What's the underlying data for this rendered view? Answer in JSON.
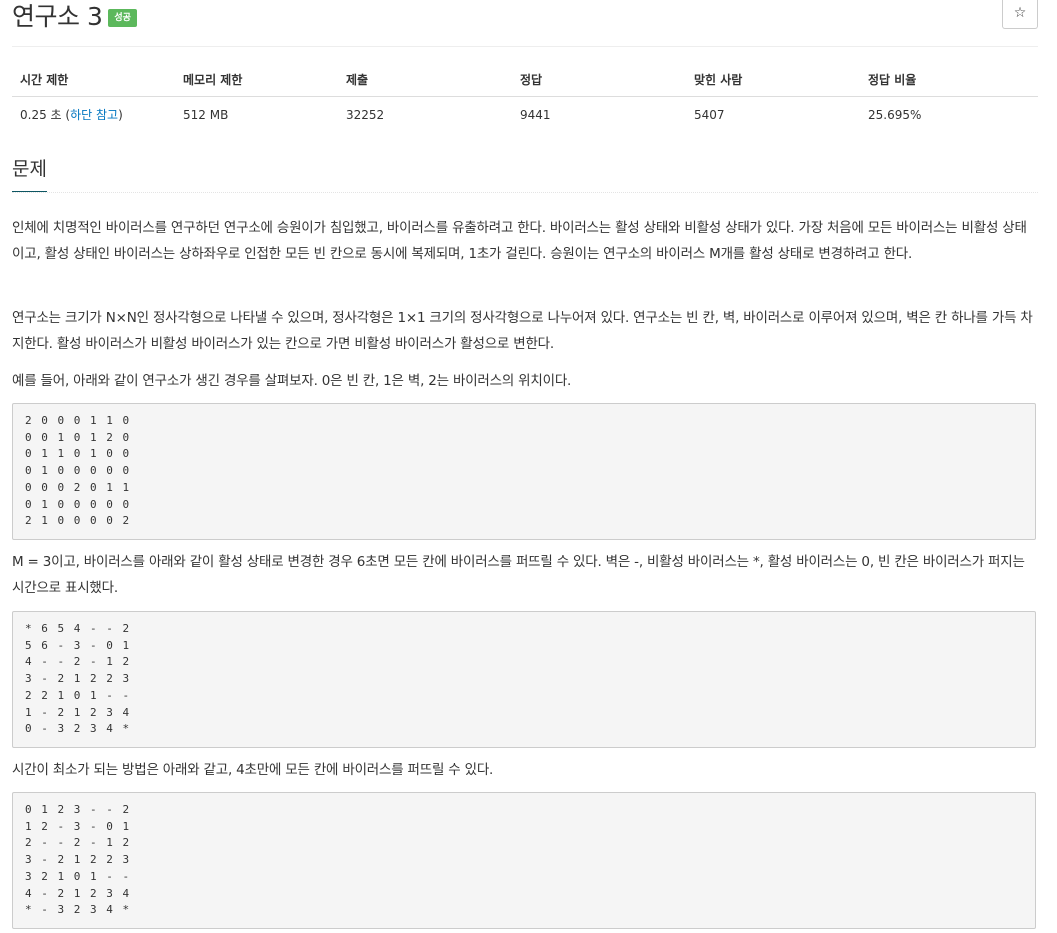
{
  "header": {
    "title": "연구소 3",
    "badge": "성공",
    "star_icon": "☆"
  },
  "info_table": {
    "headers": [
      "시간 제한",
      "메모리 제한",
      "제출",
      "정답",
      "맞힌 사람",
      "정답 비율"
    ],
    "time_prefix": "0.25 초 (",
    "time_link": "하단 참고",
    "time_suffix": ")",
    "memory": "512 MB",
    "submissions": "32252",
    "accepted": "9441",
    "solvers": "5407",
    "ratio": "25.695%"
  },
  "section": {
    "title": "문제"
  },
  "paragraphs": {
    "p1": "인체에 치명적인 바이러스를 연구하던 연구소에 승원이가 침입했고, 바이러스를 유출하려고 한다. 바이러스는 활성 상태와 비활성 상태가 있다. 가장 처음에 모든 바이러스는 비활성 상태이고, 활성 상태인 바이러스는 상하좌우로 인접한 모든 빈 칸으로 동시에 복제되며, 1초가 걸린다. 승원이는 연구소의 바이러스 M개를 활성 상태로 변경하려고 한다.",
    "p2": "연구소는 크기가 N×N인 정사각형으로 나타낼 수 있으며, 정사각형은 1×1 크기의 정사각형으로 나누어져 있다. 연구소는 빈 칸, 벽, 바이러스로 이루어져 있으며, 벽은 칸 하나를 가득 차지한다. 활성 바이러스가 비활성 바이러스가 있는 칸으로 가면 비활성 바이러스가 활성으로 변한다.",
    "p3": "예를 들어, 아래와 같이 연구소가 생긴 경우를 살펴보자. 0은 빈 칸, 1은 벽, 2는 바이러스의 위치이다.",
    "p4": "M = 3이고, 바이러스를 아래와 같이 활성 상태로 변경한 경우 6초면 모든 칸에 바이러스를 퍼뜨릴 수 있다. 벽은 -, 비활성 바이러스는 *, 활성 바이러스는 0, 빈 칸은 바이러스가 퍼지는 시간으로 표시했다.",
    "p5": "시간이 최소가 되는 방법은 아래와 같고, 4초만에 모든 칸에 바이러스를 퍼뜨릴 수 있다."
  },
  "code_blocks": {
    "grid1": "2 0 0 0 1 1 0\n0 0 1 0 1 2 0\n0 1 1 0 1 0 0\n0 1 0 0 0 0 0\n0 0 0 2 0 1 1\n0 1 0 0 0 0 0\n2 1 0 0 0 0 2",
    "grid2": "* 6 5 4 - - 2\n5 6 - 3 - 0 1\n4 - - 2 - 1 2\n3 - 2 1 2 2 3\n2 2 1 0 1 - -\n1 - 2 1 2 3 4\n0 - 3 2 3 4 *",
    "grid3": "0 1 2 3 - - 2\n1 2 - 3 - 0 1\n2 - - 2 - 1 2\n3 - 2 1 2 2 3\n3 2 1 0 1 - -\n4 - 2 1 2 3 4\n* - 3 2 3 4 *"
  }
}
